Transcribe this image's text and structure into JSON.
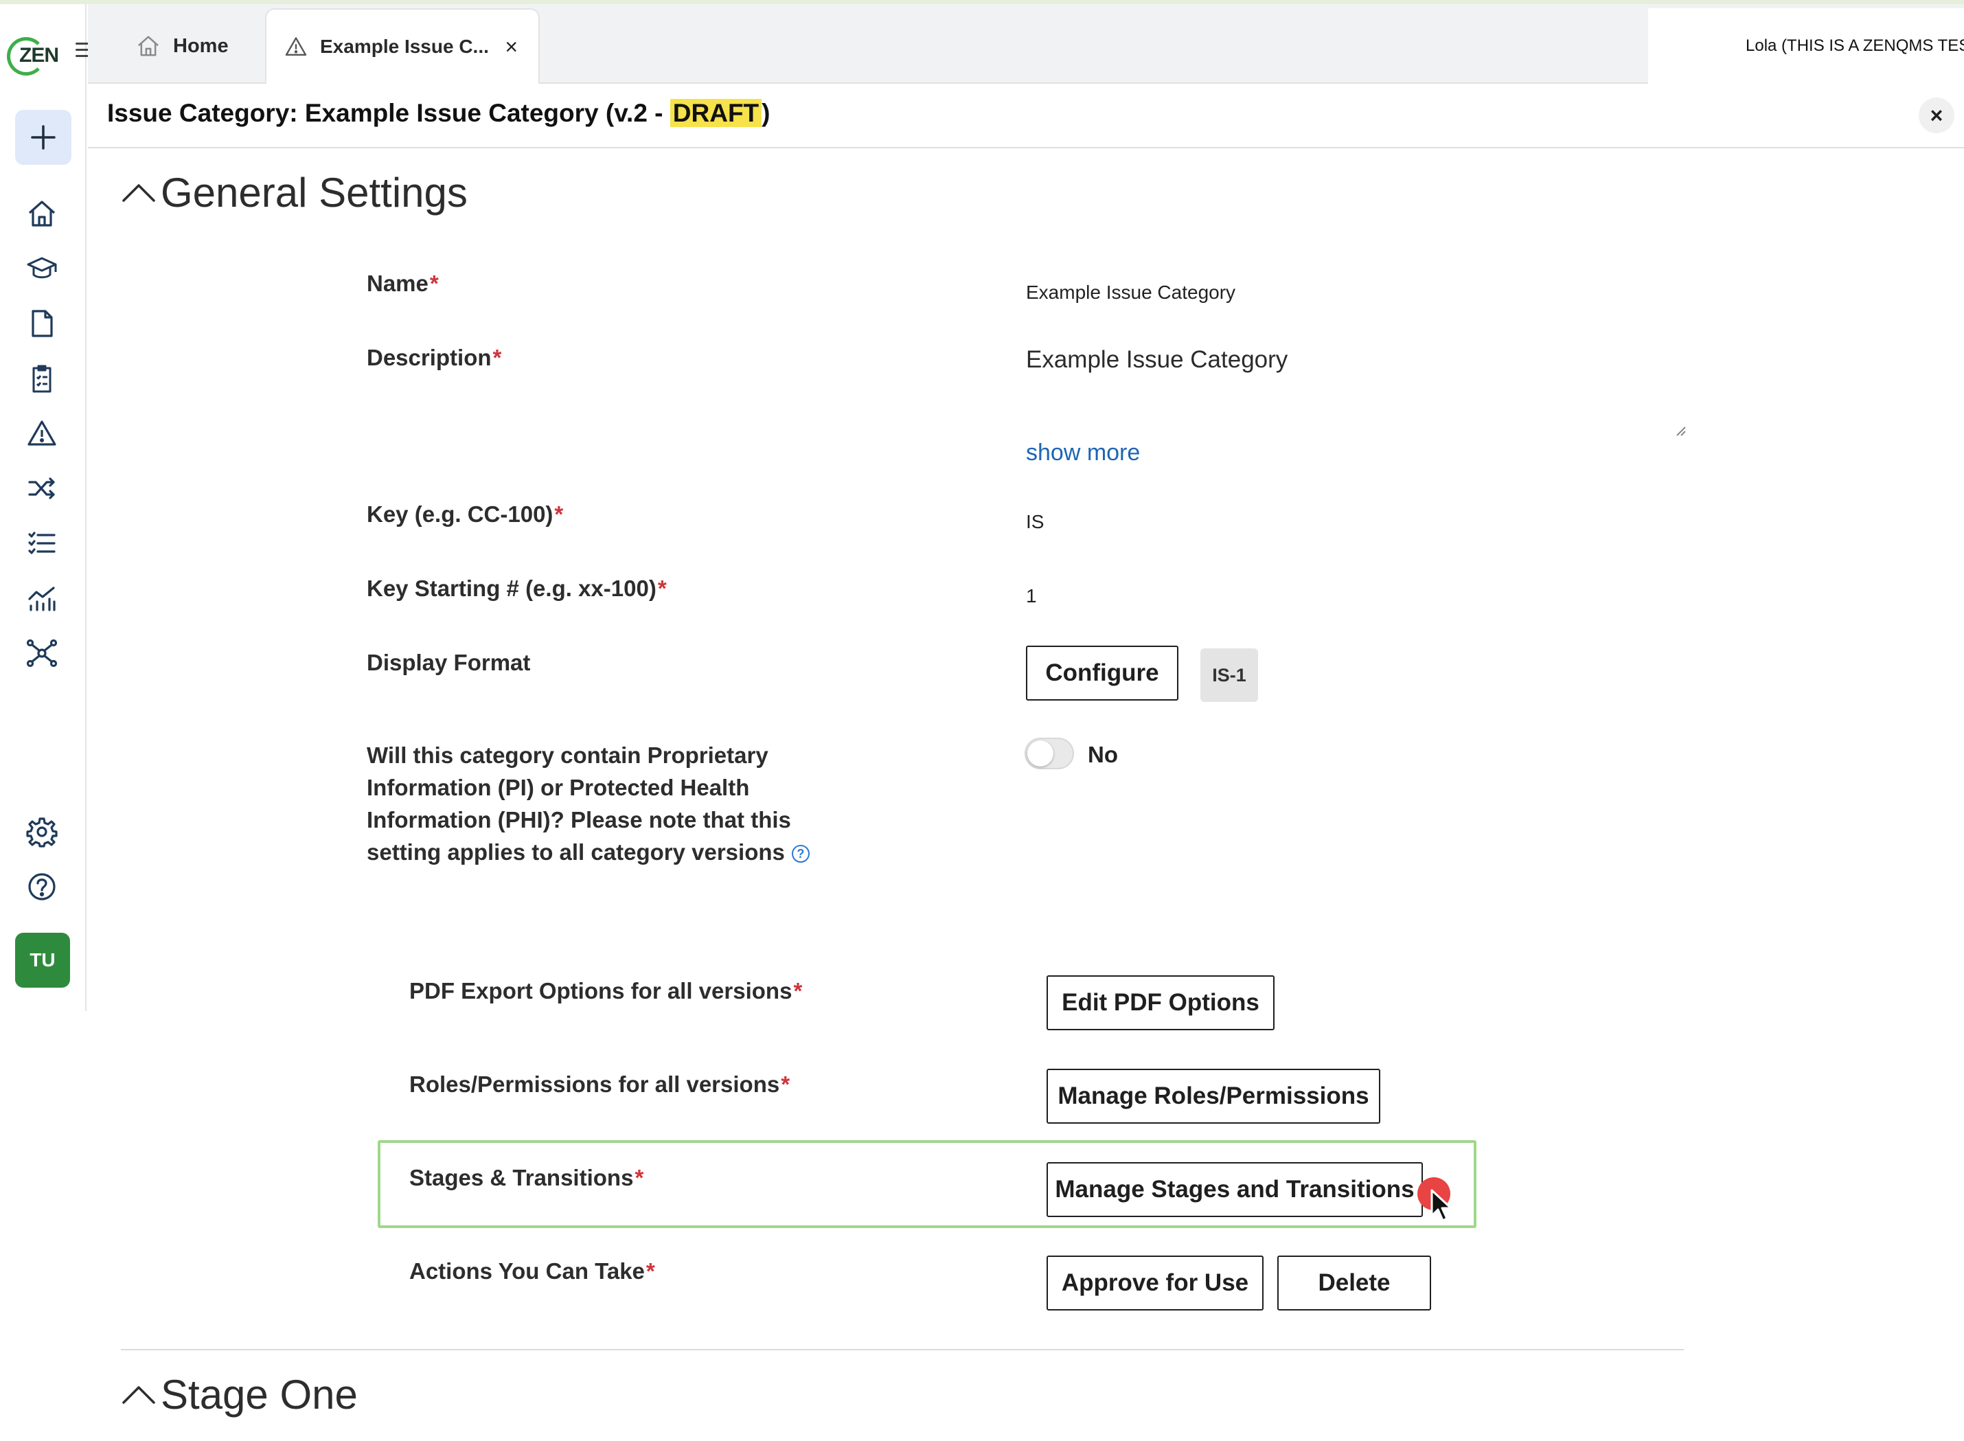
{
  "app": {
    "logo_text": "ZEN",
    "brand_color": "#3fae49"
  },
  "rail": {
    "new_icon": "plus-icon",
    "items": [
      {
        "icon": "home-icon"
      },
      {
        "icon": "graduation-cap-icon"
      },
      {
        "icon": "document-icon"
      },
      {
        "icon": "clipboard-checklist-icon"
      },
      {
        "icon": "warning-triangle-icon"
      },
      {
        "icon": "shuffle-icon"
      },
      {
        "icon": "checklist-icon"
      },
      {
        "icon": "analytics-chart-icon"
      },
      {
        "icon": "network-nodes-icon"
      },
      {
        "icon": "gear-icon"
      },
      {
        "icon": "help-circle-icon"
      }
    ],
    "avatar_initials": "TU"
  },
  "tabs": {
    "home_label": "Home",
    "active_label": "Example Issue C...",
    "close_symbol": "×"
  },
  "account": {
    "label": "Lola (THIS IS A ZENQMS TEST ACCOUNT)"
  },
  "page": {
    "title_prefix": "Issue Category: Example Issue Category (v.2 - ",
    "title_status": "DRAFT",
    "title_suffix": ")",
    "close_symbol": "×"
  },
  "general_settings": {
    "heading": "General Settings",
    "required_mark": "*",
    "name_label": "Name",
    "name_value": "Example Issue Category",
    "description_label": "Description",
    "description_value": "Example Issue Category",
    "show_more_label": "show more",
    "key_label": "Key (e.g. CC-100)",
    "key_value": "IS",
    "key_start_label": "Key Starting # (e.g. xx-100)",
    "key_start_value": "1",
    "display_format_label": "Display Format",
    "configure_label": "Configure",
    "display_format_preview": "IS-1",
    "phi_question": "Will this category contain Proprietary Information (PI) or Protected Health Information (PHI)? Please note that this setting applies to all category versions",
    "phi_help_symbol": "?",
    "phi_toggle_on": false,
    "phi_toggle_label": "No",
    "pdf_label": "PDF Export Options for all versions",
    "pdf_button": "Edit PDF Options",
    "roles_label": "Roles/Permissions for all versions",
    "roles_button": "Manage Roles/Permissions",
    "stages_label": "Stages & Transitions",
    "stages_button": "Manage Stages and Transitions",
    "actions_label": "Actions You Can Take",
    "approve_button": "Approve for Use",
    "delete_button": "Delete"
  },
  "stage_one": {
    "heading": "Stage One"
  },
  "colors": {
    "draft_highlight": "#f6e24b",
    "required": "#d0343c",
    "link": "#1d65b5",
    "focus_outline": "#9fd88b",
    "cursor_marker": "#e84444"
  }
}
